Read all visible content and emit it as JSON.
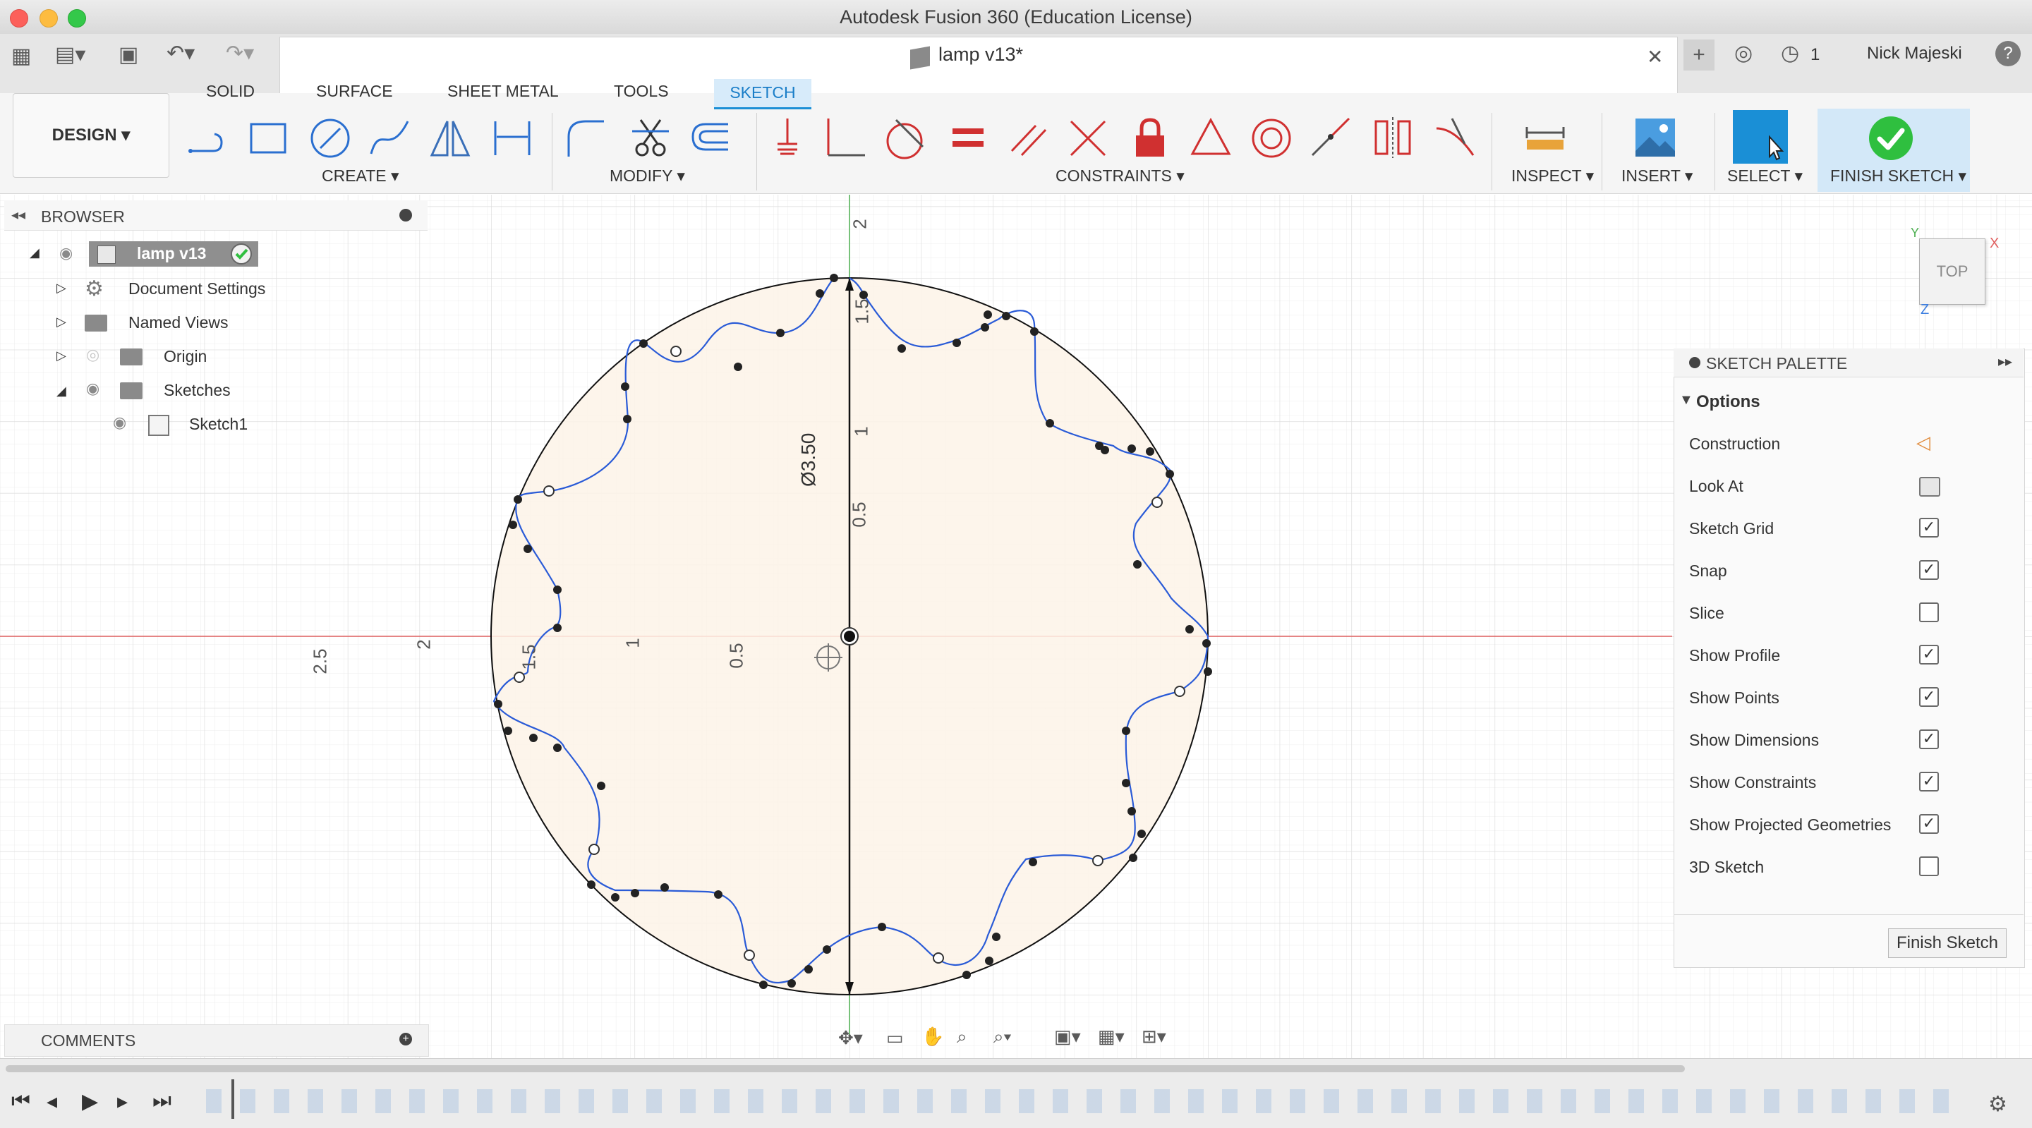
{
  "window": {
    "title": "Autodesk Fusion 360 (Education License)"
  },
  "document_tab": {
    "label": "lamp v13*",
    "close": "✕"
  },
  "quick_access": {
    "user": "Nick Majeski",
    "jobs_count": "1"
  },
  "workspace": {
    "label": "DESIGN"
  },
  "toolbar_tabs": [
    "SOLID",
    "SURFACE",
    "SHEET METAL",
    "TOOLS",
    "SKETCH"
  ],
  "tool_groups": {
    "create": "CREATE",
    "modify": "MODIFY",
    "constraints": "CONSTRAINTS",
    "inspect": "INSPECT",
    "insert": "INSERT",
    "select": "SELECT",
    "finish": "FINISH SKETCH"
  },
  "browser": {
    "title": "BROWSER",
    "items": [
      {
        "label": "lamp v13"
      },
      {
        "label": "Document Settings"
      },
      {
        "label": "Named Views"
      },
      {
        "label": "Origin"
      },
      {
        "label": "Sketches"
      },
      {
        "label": "Sketch1"
      }
    ]
  },
  "comments": {
    "title": "COMMENTS"
  },
  "viewcube": {
    "face": "TOP",
    "axis_x": "X",
    "axis_y": "Y",
    "axis_z": "Z"
  },
  "canvas": {
    "dimension_label": "Ø3.50",
    "tick_labels_vertical": [
      "2",
      "1.5",
      "1",
      "0.5"
    ],
    "tick_labels_horizontal": [
      "2.5",
      "2",
      "1.5",
      "1",
      "0.5"
    ]
  },
  "sketch_palette": {
    "title": "SKETCH PALETTE",
    "section": "Options",
    "options": [
      {
        "label": "Construction",
        "control": "icon"
      },
      {
        "label": "Look At",
        "control": "icon"
      },
      {
        "label": "Sketch Grid",
        "checked": true
      },
      {
        "label": "Snap",
        "checked": true
      },
      {
        "label": "Slice",
        "checked": false
      },
      {
        "label": "Show Profile",
        "checked": true
      },
      {
        "label": "Show Points",
        "checked": true
      },
      {
        "label": "Show Dimensions",
        "checked": true
      },
      {
        "label": "Show Constraints",
        "checked": true
      },
      {
        "label": "Show Projected Geometries",
        "checked": true
      },
      {
        "label": "3D Sketch",
        "checked": false
      }
    ],
    "finish_button": "Finish Sketch"
  },
  "colors": {
    "accent": "#1a8fd6",
    "profile_fill": "#fdf3e7",
    "curve": "#2a5bd7",
    "x_axis": "#e06060",
    "y_axis": "#4caf50",
    "constraint_red": "#d03030",
    "finish_green": "#2fbf3f"
  }
}
